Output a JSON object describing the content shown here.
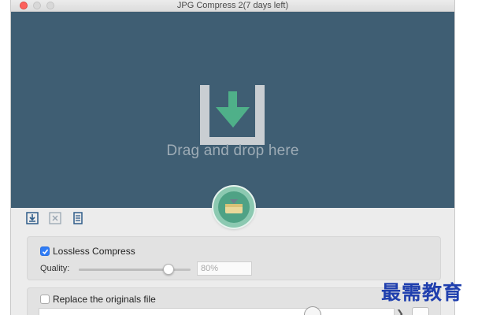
{
  "window": {
    "title": "JPG Compress 2(7 days left)"
  },
  "dropzone": {
    "prompt": "Drag and drop here"
  },
  "toolbar": {
    "items": [
      {
        "icon": "add-file-icon"
      },
      {
        "icon": "remove-file-icon"
      },
      {
        "icon": "list-icon"
      }
    ]
  },
  "fab": {
    "icon": "compress-start-icon"
  },
  "options": {
    "lossless": {
      "label": "Lossless Compress",
      "checked": true
    },
    "quality": {
      "label": "Quality:",
      "value": "80%",
      "level": 0.8
    },
    "replace": {
      "label": "Replace the originals file",
      "checked": false
    }
  },
  "watermark": {
    "text": "最需教育"
  },
  "colors": {
    "dropzone_bg": "#3f5e73",
    "accent_green": "#4fa285",
    "checkbox_blue": "#2f7cf6"
  }
}
